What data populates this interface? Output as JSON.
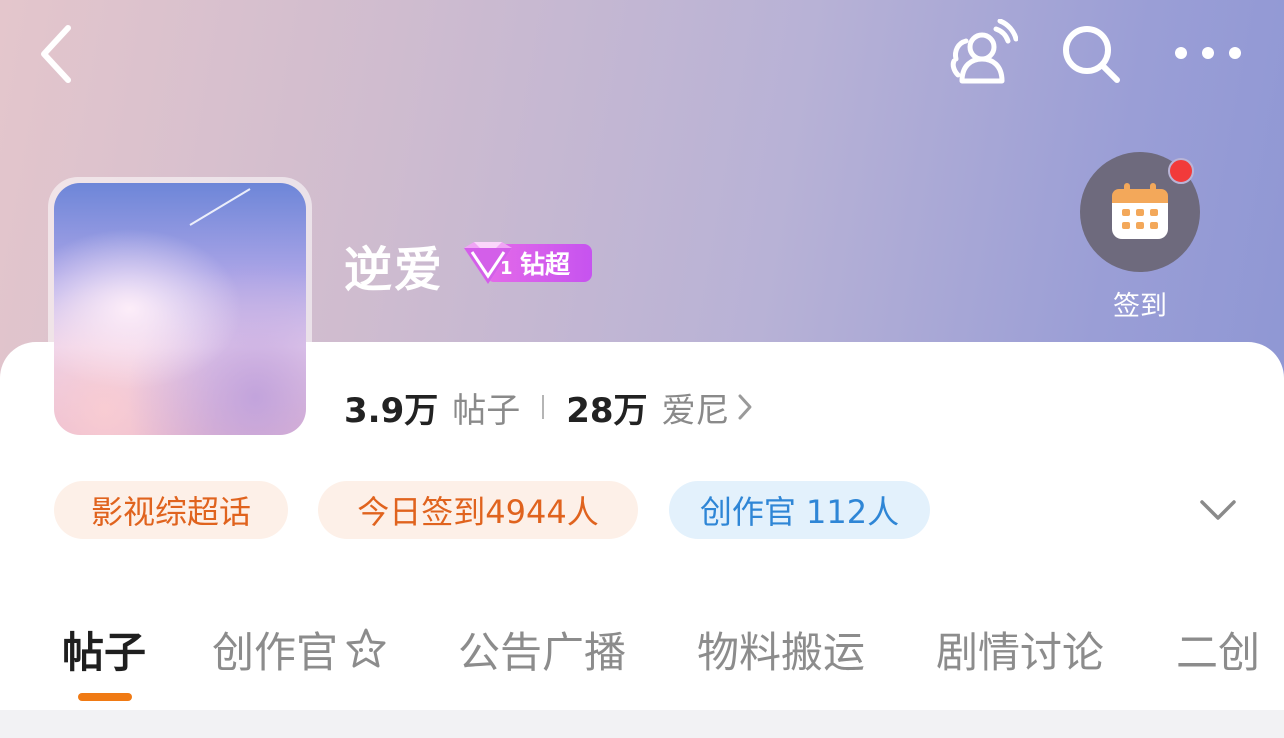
{
  "header": {
    "back_icon": "chevron-left-icon",
    "notify_icon": "user-broadcast-icon",
    "search_icon": "search-icon",
    "more_icon": "ellipsis-icon"
  },
  "checkin": {
    "label": "签到",
    "icon": "calendar-icon",
    "has_notification_dot": true
  },
  "topic": {
    "name": "逆爱",
    "badge": {
      "level": "1",
      "label": "钻超",
      "icon": "diamond-icon"
    }
  },
  "stats": {
    "posts_count": "3.9万",
    "posts_label": "帖子",
    "fans_count": "28万",
    "fans_label": "爱尼"
  },
  "tags": [
    {
      "label": "影视综超话"
    },
    {
      "label": "今日签到4944人"
    },
    {
      "label": "创作官 112人"
    }
  ],
  "tabs": [
    {
      "label": "帖子",
      "active": true
    },
    {
      "label": "创作官",
      "icon": "star-cat-icon"
    },
    {
      "label": "公告广播"
    },
    {
      "label": "物料搬运"
    },
    {
      "label": "剧情讨论"
    },
    {
      "label": "二创"
    }
  ],
  "colors": {
    "accent_orange": "#f07a14",
    "tag_orange_text": "#e0631e",
    "tag_blue_text": "#2f86d6",
    "badge_purple": "#d25ff0",
    "red_dot": "#f23a3a"
  }
}
